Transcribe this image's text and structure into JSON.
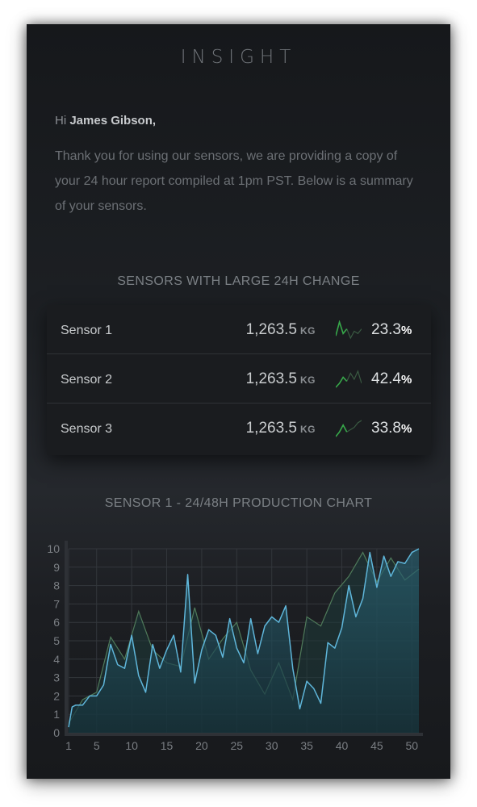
{
  "app": {
    "brand": "INSIGHT"
  },
  "greeting": {
    "prefix": "Hi ",
    "name": "James Gibson,"
  },
  "intro": "Thank you for using our sensors, we are providing a copy of your 24 hour report compiled at 1pm PST. Below is a summary of your sensors.",
  "sections": {
    "large_change_title": "SENSORS WITH LARGE 24H CHANGE",
    "chart_title": "SENSOR 1 - 24/48H PRODUCTION CHART"
  },
  "sensors": [
    {
      "name": "Sensor 1",
      "value": "1,263.5",
      "unit": "KG",
      "change": "23.3",
      "pct_symbol": "%",
      "spark_icon": "trend-spark-icon",
      "spark": [
        3,
        9,
        4,
        6,
        2,
        5,
        4,
        6
      ]
    },
    {
      "name": "Sensor 2",
      "value": "1,263.5",
      "unit": "KG",
      "change": "42.4",
      "pct_symbol": "%",
      "spark_icon": "trend-spark-icon",
      "spark": [
        1,
        3,
        6,
        4,
        8,
        5,
        9,
        3
      ]
    },
    {
      "name": "Sensor 3",
      "value": "1,263.5",
      "unit": "KG",
      "change": "33.8",
      "pct_symbol": "%",
      "spark_icon": "trend-spark-icon",
      "spark": [
        1,
        3,
        6,
        3,
        4,
        5,
        7,
        8
      ]
    }
  ],
  "colors": {
    "accent_line": "#5fb6da",
    "area_fill": "#1f4550",
    "series2_line": "#4f7a5a",
    "spark_green": "#37a84a",
    "spark_dim": "#3a5a42"
  },
  "chart_data": {
    "type": "area",
    "title": "SENSOR 1 - 24/48H PRODUCTION CHART",
    "xlabel": "",
    "ylabel": "",
    "xlim": [
      1,
      51
    ],
    "ylim": [
      0,
      10
    ],
    "x_ticks": [
      1,
      5,
      10,
      15,
      20,
      25,
      30,
      35,
      40,
      45,
      50
    ],
    "y_ticks": [
      0,
      1,
      2,
      3,
      4,
      5,
      6,
      7,
      8,
      9,
      10
    ],
    "grid": true,
    "series": [
      {
        "x": [
          1,
          1.5,
          2,
          3,
          4,
          5,
          6,
          7,
          8,
          9,
          10,
          11,
          12,
          13,
          14,
          15,
          16,
          17,
          18,
          19,
          20,
          21,
          22,
          23,
          24,
          25,
          26,
          27,
          28,
          29,
          30,
          31,
          32,
          33,
          34,
          35,
          36,
          37,
          38,
          39,
          40,
          41,
          42,
          43,
          44,
          45,
          46,
          47,
          48,
          49,
          50,
          51
        ],
        "values": [
          0.3,
          1.4,
          1.5,
          1.5,
          2.0,
          2.0,
          2.6,
          4.8,
          3.7,
          3.5,
          5.3,
          3.1,
          2.2,
          4.8,
          3.5,
          4.5,
          5.3,
          3.3,
          8.6,
          2.7,
          4.5,
          5.6,
          5.3,
          4.1,
          6.2,
          4.6,
          3.8,
          6.2,
          4.3,
          5.8,
          6.3,
          6.0,
          6.9,
          3.5,
          1.3,
          2.8,
          2.4,
          1.6,
          4.9,
          4.6,
          5.7,
          8.0,
          6.3,
          7.3,
          9.8,
          7.9,
          9.6,
          8.5,
          9.3,
          9.2,
          9.8,
          10.0
        ]
      },
      {
        "x": [
          1,
          3,
          5,
          7,
          9,
          11,
          13,
          15,
          17,
          19,
          21,
          23,
          25,
          27,
          29,
          31,
          33,
          35,
          37,
          39,
          41,
          43,
          45,
          47,
          49,
          51
        ],
        "values": [
          0.5,
          1.8,
          2.2,
          5.2,
          4.0,
          6.6,
          4.5,
          3.8,
          3.6,
          6.8,
          4.0,
          5.1,
          6.0,
          3.4,
          2.1,
          3.8,
          1.8,
          6.3,
          5.8,
          7.6,
          8.5,
          9.8,
          8.2,
          9.5,
          8.3,
          8.9
        ]
      }
    ]
  }
}
